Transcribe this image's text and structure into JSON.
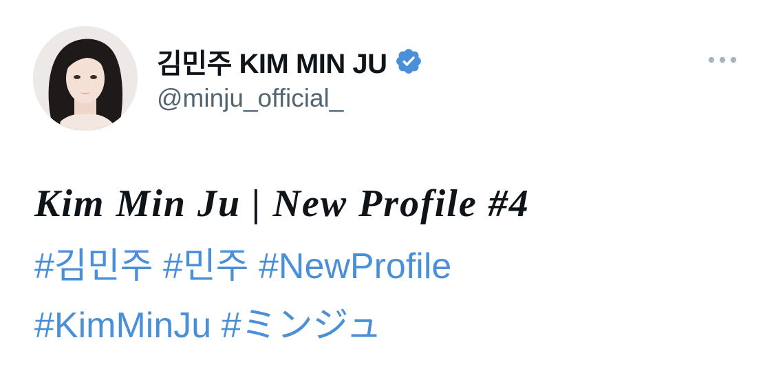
{
  "tweet": {
    "author": {
      "display_name": "김민주 KIM MIN JU",
      "handle": "@minju_official_",
      "verified": true,
      "avatar_icon": "profile-photo"
    },
    "more_icon": "more-horizontal-icon",
    "text": {
      "title": "Kim Min Ju | New Profile #4",
      "hashtag_lines": [
        [
          "#김민주",
          "#민주",
          "#NewProfile"
        ],
        [
          "#KimMinJu",
          "#ミンジュ"
        ]
      ]
    }
  },
  "colors": {
    "text_primary": "#0f1419",
    "text_secondary": "#536471",
    "hashtag": "#4a90d9",
    "verified_badge": "#4a90d9",
    "more_icon": "#aab4bd"
  }
}
